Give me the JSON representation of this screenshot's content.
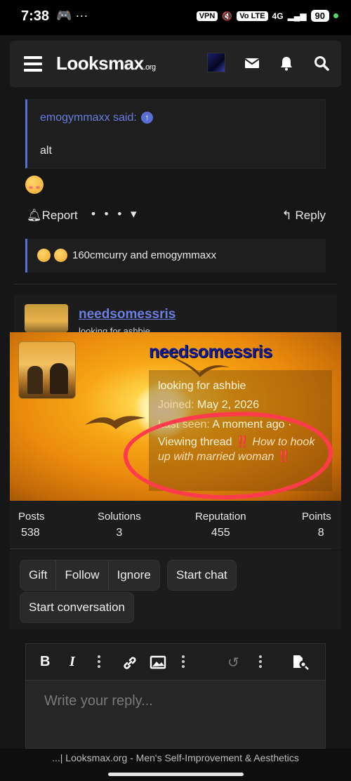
{
  "status_bar": {
    "time": "7:38",
    "left_icons": "🎮 ···",
    "vpn": "VPN",
    "volte": "Vo LTE",
    "network": "4G",
    "battery": "90"
  },
  "header": {
    "logo": "Looksmax",
    "logo_tld": ".org",
    "icons": [
      "menu-icon",
      "mail-icon",
      "bell-icon",
      "search-icon"
    ]
  },
  "quote": {
    "author": "emogymmaxx said:",
    "text": "alt"
  },
  "post_actions": {
    "report": "Report",
    "more": "• • • ▾",
    "reply": "Reply"
  },
  "reactions": {
    "text": "160cmcurry and emogymmaxx"
  },
  "next_post": {
    "username": "needsomessris",
    "subtitle": "looking for ashbie"
  },
  "profile_card": {
    "username": "needsomessris",
    "status": "looking for ashbie",
    "joined_label": "Joined:",
    "joined_value": "May 2, 2026",
    "last_seen_label": "Last seen:",
    "last_seen_value": "A moment ago ·",
    "viewing_label": "Viewing thread",
    "thread_mark_1": "‼️",
    "thread_title": "How to hook up with married woman",
    "thread_mark_2": "‼️"
  },
  "stats": [
    {
      "label": "Posts",
      "value": "538"
    },
    {
      "label": "Solutions",
      "value": "3"
    },
    {
      "label": "Reputation",
      "value": "455"
    },
    {
      "label": "Points",
      "value": "8"
    }
  ],
  "buttons": {
    "gift": "Gift",
    "follow": "Follow",
    "ignore": "Ignore",
    "start_chat": "Start chat",
    "start_conversation": "Start conversation"
  },
  "editor": {
    "placeholder": "Write your reply..."
  },
  "footer": {
    "title": "...| Looksmax.org - Men's Self-Improvement & Aesthetics"
  },
  "colors": {
    "accent": "#6b7fe0",
    "annotation": "#ff3b4c",
    "background": "#161616"
  }
}
